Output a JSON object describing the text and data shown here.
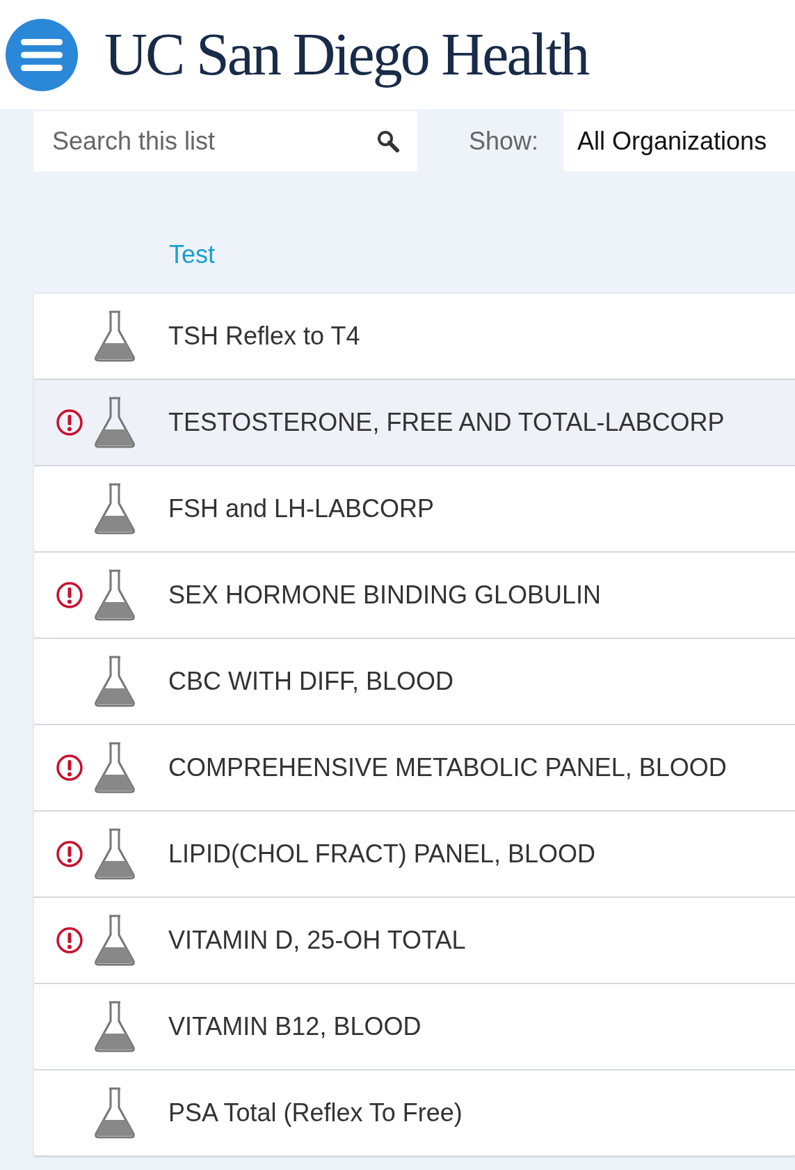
{
  "header": {
    "logo": "UC San Diego Health"
  },
  "search": {
    "placeholder": "Search this list"
  },
  "filter": {
    "label": "Show:",
    "value": "All Organizations"
  },
  "table": {
    "columns": [
      {
        "label": "Test"
      }
    ],
    "rows": [
      {
        "name": "TSH Reflex to T4",
        "flagged": false,
        "selected": false
      },
      {
        "name": "TESTOSTERONE, FREE AND TOTAL-LABCORP",
        "flagged": true,
        "selected": true
      },
      {
        "name": "FSH and LH-LABCORP",
        "flagged": false,
        "selected": false
      },
      {
        "name": "SEX HORMONE BINDING GLOBULIN",
        "flagged": true,
        "selected": false
      },
      {
        "name": "CBC WITH DIFF, BLOOD",
        "flagged": false,
        "selected": false
      },
      {
        "name": "COMPREHENSIVE METABOLIC PANEL, BLOOD",
        "flagged": true,
        "selected": false
      },
      {
        "name": "LIPID(CHOL FRACT) PANEL, BLOOD",
        "flagged": true,
        "selected": false
      },
      {
        "name": "VITAMIN D, 25-OH TOTAL",
        "flagged": true,
        "selected": false
      },
      {
        "name": "VITAMIN B12, BLOOD",
        "flagged": false,
        "selected": false
      },
      {
        "name": "PSA Total (Reflex To Free)",
        "flagged": false,
        "selected": false
      }
    ]
  }
}
